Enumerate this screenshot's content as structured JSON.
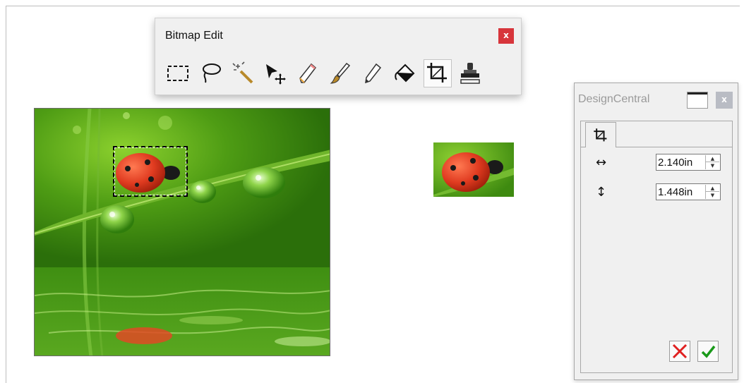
{
  "toolbar": {
    "title": "Bitmap Edit",
    "close_label": "x",
    "tools": [
      {
        "name": "rectangle-select-icon",
        "active": false
      },
      {
        "name": "lasso-select-icon",
        "active": false
      },
      {
        "name": "magic-wand-icon",
        "active": false
      },
      {
        "name": "move-arrow-icon",
        "active": false
      },
      {
        "name": "eraser-icon",
        "active": false
      },
      {
        "name": "brush-icon",
        "active": false
      },
      {
        "name": "pencil-icon",
        "active": false
      },
      {
        "name": "paint-bucket-icon",
        "active": false
      },
      {
        "name": "crop-icon",
        "active": true
      },
      {
        "name": "stamp-icon",
        "active": false
      }
    ]
  },
  "panel": {
    "title": "DesignCentral",
    "close_label": "x",
    "tab_icon": "crop-icon",
    "width": {
      "icon": "↔",
      "value": "2.140in"
    },
    "height": {
      "icon": "↕",
      "value": "1.448in"
    },
    "cancel_icon": "cancel-x-icon",
    "ok_icon": "checkmark-icon"
  },
  "colors": {
    "close_red": "#d7353b",
    "cancel_red": "#e02020",
    "ok_green": "#1a9a1a",
    "leaf_green": "#4f9a17",
    "ladybug_red": "#d63a22"
  }
}
